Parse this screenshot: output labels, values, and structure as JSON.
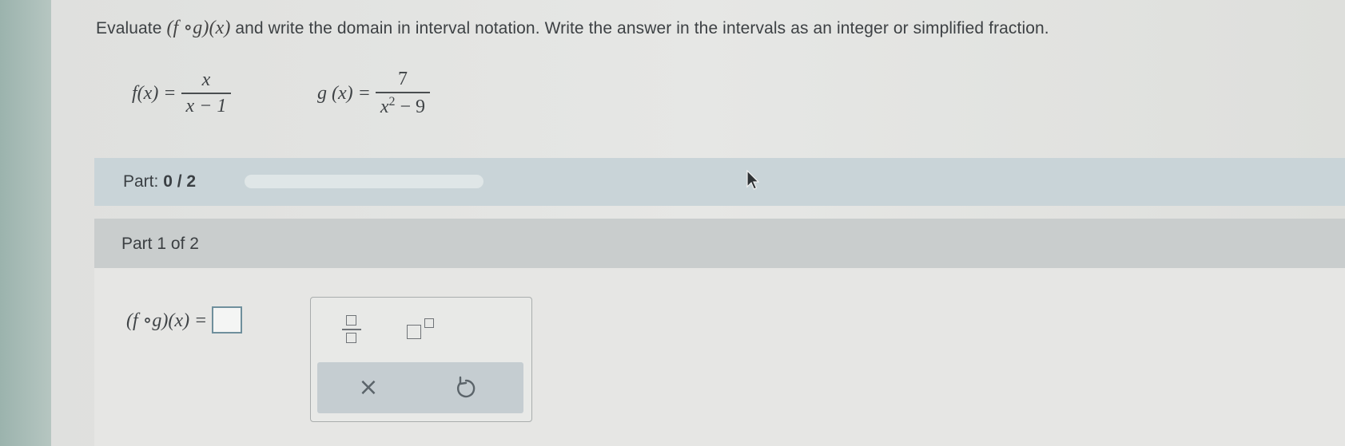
{
  "instructions": {
    "prefix": "Evaluate",
    "expression": "(f ∘g)(x)",
    "suffix": "and write the domain in interval notation. Write the answer in the intervals as an integer or simplified fraction."
  },
  "functions": {
    "f": {
      "label": "f(x) =",
      "numerator": "x",
      "denominator": "x − 1"
    },
    "g": {
      "label": "g (x) =",
      "numerator": "7",
      "denominator_base": "x",
      "denominator_exp": "2",
      "denominator_rest": " − 9"
    }
  },
  "progress": {
    "label_prefix": "Part:",
    "label_value": "0 / 2",
    "completed": 0,
    "total": 2,
    "fill_fraction": 0
  },
  "part": {
    "header": "Part 1 of 2",
    "answer_lhs": "(f ∘g)(x) ="
  },
  "palette": {
    "fraction_icon": "fraction-icon",
    "exponent_icon": "exponent-icon",
    "clear_label": "×",
    "undo_icon": "undo-icon"
  },
  "colors": {
    "accent": "#5f9bb0",
    "progress_band": "#c9d4d8",
    "part_header": "#c9cdcd",
    "answer_border": "#6f8f9c"
  }
}
